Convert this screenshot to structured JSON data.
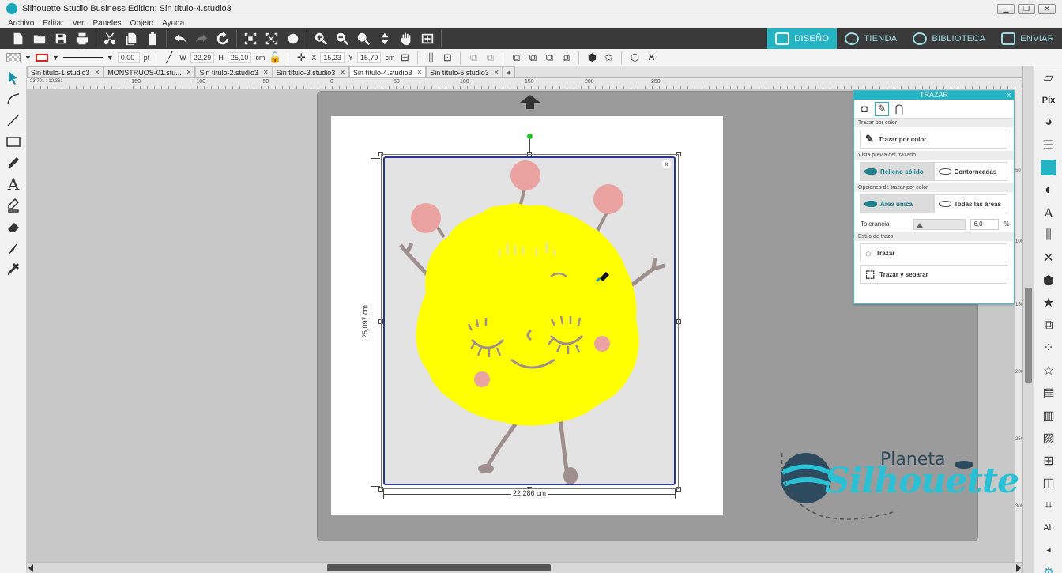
{
  "window": {
    "title": "Silhouette Studio Business Edition: Sin título-4.studio3",
    "min": "▁",
    "max": "❐",
    "close": "✕"
  },
  "menu": [
    "Archivo",
    "Editar",
    "Ver",
    "Paneles",
    "Objeto",
    "Ayuda"
  ],
  "navtabs": [
    {
      "label": "DISEÑO",
      "active": true
    },
    {
      "label": "TIENDA",
      "active": false
    },
    {
      "label": "BIBLIOTECA",
      "active": false
    },
    {
      "label": "ENVIAR",
      "active": false
    }
  ],
  "propbar": {
    "line_width": "0,00",
    "line_unit": "pt",
    "w_label": "W",
    "w_value": "22,29",
    "h_label": "H",
    "h_value": "25,10",
    "size_unit": "cm",
    "x_label": "X",
    "x_value": "15,23",
    "y_label": "Y",
    "y_value": "15,79",
    "pos_unit": "cm"
  },
  "doctabs": [
    {
      "label": "Sin título-1.studio3",
      "active": false
    },
    {
      "label": "MONSTRUOS-01.stu...",
      "active": false
    },
    {
      "label": "Sin título-2.studio3",
      "active": false
    },
    {
      "label": "Sin título-3.studio3",
      "active": false
    },
    {
      "label": "Sin título-4.studio3",
      "active": true
    },
    {
      "label": "Sin título-5.studio3",
      "active": false
    }
  ],
  "ruler_h": [
    "-150",
    "-100",
    "-50",
    "0",
    "50",
    "100",
    "150",
    "200",
    "250"
  ],
  "ruler_v": [
    "50",
    "100",
    "150",
    "200",
    "250",
    "300"
  ],
  "coord_readout": "23,701 : 12,361",
  "canvas": {
    "width_label": "22,286 cm",
    "height_label": "25,097 cm",
    "close_glyph": "x",
    "colors": {
      "body": "#ffff00",
      "cheeks": "#eaa3a0",
      "limbs": "#9e8f8c",
      "frame": "#283593",
      "bg": "#e3e3e3"
    }
  },
  "trazar_panel": {
    "title": "TRAZAR",
    "close": "x",
    "section_color": "Trazar por color",
    "btn_trazar_color": "Trazar por color",
    "section_preview": "Vista previa del trazado",
    "opt_solid": "Relleno sólido",
    "opt_outline": "Contorneadas",
    "section_options": "Opciones de trazar por color",
    "opt_single": "Área única",
    "opt_all": "Todas las áreas",
    "tolerance_label": "Tolerancia",
    "tolerance_value": "6,0",
    "tolerance_unit": "%",
    "section_style": "Estilo de trazo",
    "btn_trace": "Trazar",
    "btn_trace_separate": "Trazar y separar"
  },
  "watermark": {
    "line1": "Planeta",
    "line2": "Silhouette"
  }
}
